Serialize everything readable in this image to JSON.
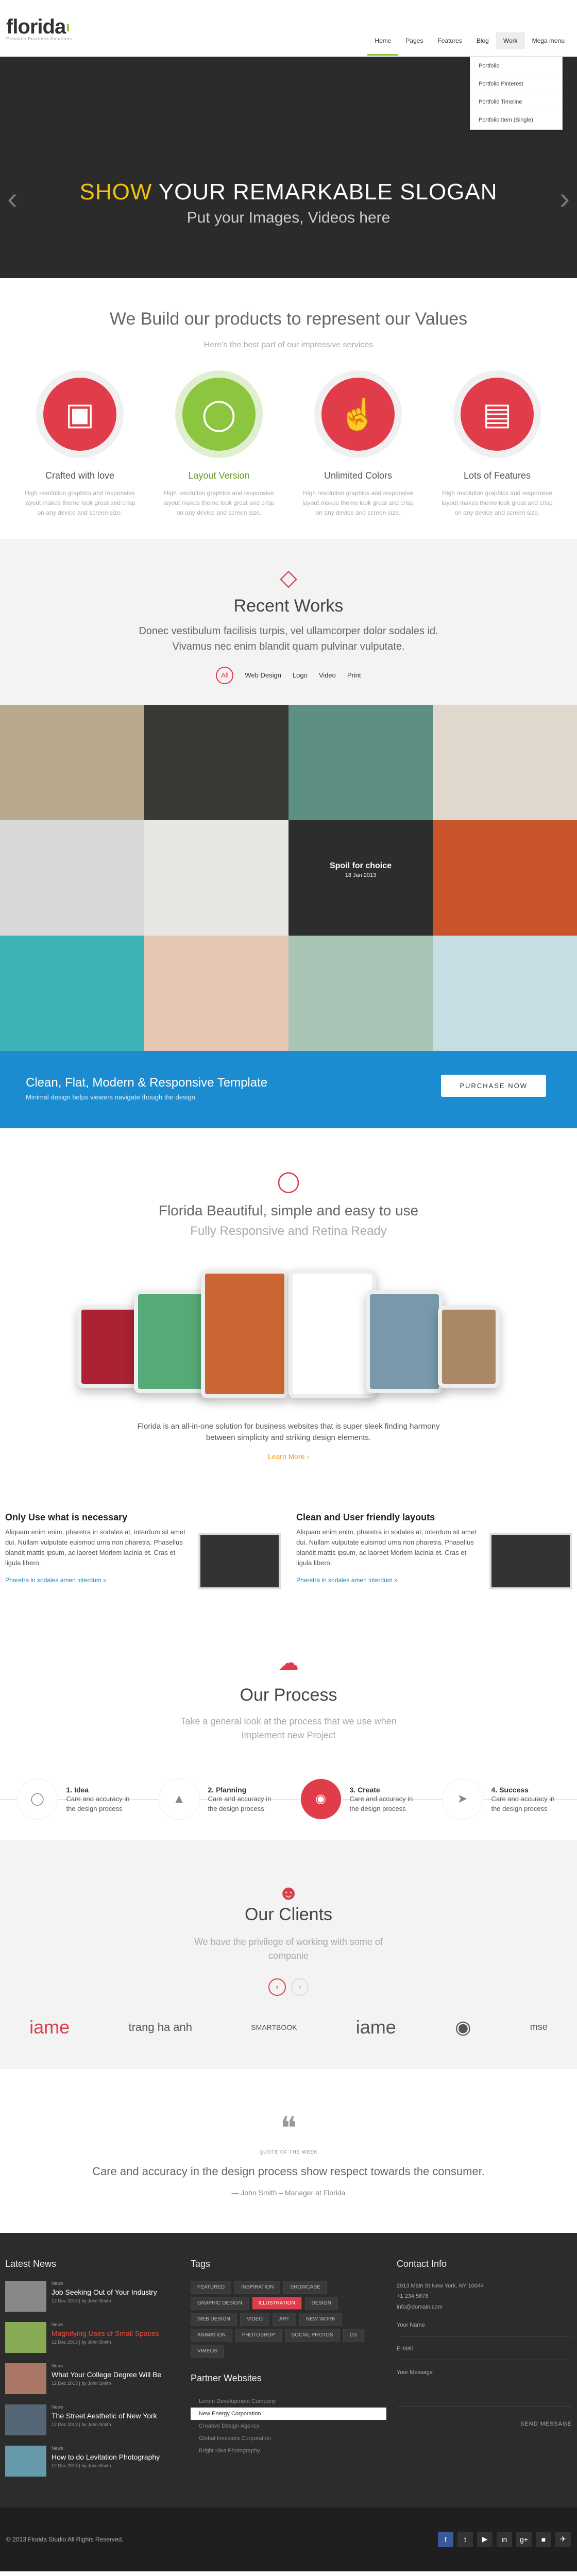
{
  "header": {
    "logo": "florida",
    "tagline": "Premium Business Solutions",
    "nav": [
      "Home",
      "Pages",
      "Features",
      "Blog",
      "Work",
      "Mega menu"
    ],
    "dropdown": [
      "Portfolio",
      "Portfolio Pinterest",
      "Portfolio Timeline",
      "Portfolio Item (Single)"
    ]
  },
  "slider": {
    "show": "SHOW",
    "rest": "YOUR REMARKABLE SLOGAN",
    "sub": "Put your Images, Videos here"
  },
  "values": {
    "title": "We Build our products to represent our Values",
    "sub": "Here's the best part of our impressive services",
    "items": [
      {
        "title": "Crafted with love",
        "text": "High resolution graphics and responsive layout makes theme look great and crisp on any device and screen size."
      },
      {
        "title": "Layout Version",
        "text": "High resolution graphics and responsive layout makes theme look great and crisp on any device and screen size."
      },
      {
        "title": "Unlimited Colors",
        "text": "High resolution graphics and responsive layout makes theme look great and crisp on any device and screen size."
      },
      {
        "title": "Lots of Features",
        "text": "High resolution graphics and responsive layout makes theme look great and crisp on any device and screen size."
      }
    ]
  },
  "recent": {
    "title": "Recent Works",
    "text": "Donec vestibulum facilisis turpis, vel ullamcorper dolor sodales id. Vivamus nec enim blandit quam pulvinar vulputate.",
    "filters": [
      "All",
      "Web Design",
      "Logo",
      "Video",
      "Print"
    ],
    "spot_title": "Spoil for choice",
    "spot_date": "18 Jan 2013"
  },
  "banner": {
    "title": "Clean, Flat, Modern & Responsive Template",
    "text": "Minimal design helps viewers navigate though the design.",
    "button": "PURCHASE NOW"
  },
  "florida": {
    "title": "Florida Beautiful, simple and easy to use",
    "sub": "Fully Responsive and Retina Ready",
    "text": "Florida is an all-in-one solution for business websites that is super sleek finding harmony between simplicity and striking design elements.",
    "link": "Learn More ›"
  },
  "features": [
    {
      "title": "Only Use what is necessary",
      "text": "Aliquam enim enim, pharetra in sodales at, interdum sit amet dui. Nullam vulputate euismod urna non pharetra. Phasellus blandit mattis ipsum, ac laoreet Morlem lacinia et. Cras et ligula libero.",
      "link": "Pharetra in sodales amen interdum »"
    },
    {
      "title": "Clean and User friendly layouts",
      "text": "Aliquam enim enim, pharetra in sodales at, interdum sit amet dui. Nullam vulputate euismod urna non pharetra. Phasellus blandit mattis ipsum, ac laoreet Morlem lacinia et. Cras et ligula libero.",
      "link": "Pharetra in sodales amen interdum »"
    }
  ],
  "process": {
    "title": "Our Process",
    "sub": "Take a general look at the process that we use when Implement new Project",
    "steps": [
      {
        "title": "1. Idea",
        "text": "Care and accuracy in the design process"
      },
      {
        "title": "2. Planning",
        "text": "Care and accuracy in the design process"
      },
      {
        "title": "3. Create",
        "text": "Care and accuracy in the design process"
      },
      {
        "title": "4. Success",
        "text": "Care and accuracy in the design process"
      }
    ]
  },
  "clients": {
    "title": "Our Clients",
    "sub": "We have the privilege of working with some of companie",
    "logos": [
      "iame",
      "trang ha anh",
      "SMARTBOOK",
      "iame",
      "◉",
      "mse"
    ]
  },
  "quote": {
    "label": "QUOTE OF THE WEEK",
    "text": "Care and accuracy in the design process show respect towards the consumer.",
    "author": "— John Smith – Manager at Florida"
  },
  "footer": {
    "news_title": "Latest News",
    "news": [
      {
        "tag": "News",
        "title": "Job Seeking Out of Your Industry",
        "meta": "12 Dec 2013 | by John Smith"
      },
      {
        "tag": "News",
        "title": "Magnifying Uses of Small Spaces",
        "meta": "12 Dec 2013 | by John Smith"
      },
      {
        "tag": "News",
        "title": "What Your College Degree Will Be",
        "meta": "12 Dec 2013 | by John Smith"
      },
      {
        "tag": "News",
        "title": "The Street Aesthetic of New York",
        "meta": "12 Dec 2013 | by John Smith"
      },
      {
        "tag": "News",
        "title": "How to do Levitation Photography",
        "meta": "12 Dec 2013 | by John Smith"
      }
    ],
    "tags_title": "Tags",
    "tags": [
      "FEATURED",
      "INSPIRATION",
      "SHOWCASE",
      "GRAPHIC DESIGN",
      "ILLUSTRATION",
      "DESIGN",
      "WEB DESIGN",
      "VIDEO",
      "ART",
      "NEW WORK",
      "ANIMATION",
      "PHOTOSHOP",
      "SOCIAL PHOTOS",
      "CS",
      "VIMEOS"
    ],
    "partners_title": "Partner Websites",
    "partners": [
      "Lorem Development Company",
      "New Energy Corporation",
      "Creative Design Agency",
      "Global Investors Corporation",
      "Bright Idea Photography"
    ],
    "contact_title": "Contact Info",
    "contact": [
      "2013 Main St New York, NY 10044",
      "+1 234 5678",
      "info@domain.com"
    ],
    "fields": [
      "Your Name",
      "E-Mail",
      "Your Message"
    ],
    "send": "SEND MESSAGE",
    "copy": "© 2013 Florida Studio All Rights Reserved.",
    "social": [
      "f",
      "t",
      "▶",
      "in",
      "g+",
      "■",
      "✈"
    ]
  }
}
